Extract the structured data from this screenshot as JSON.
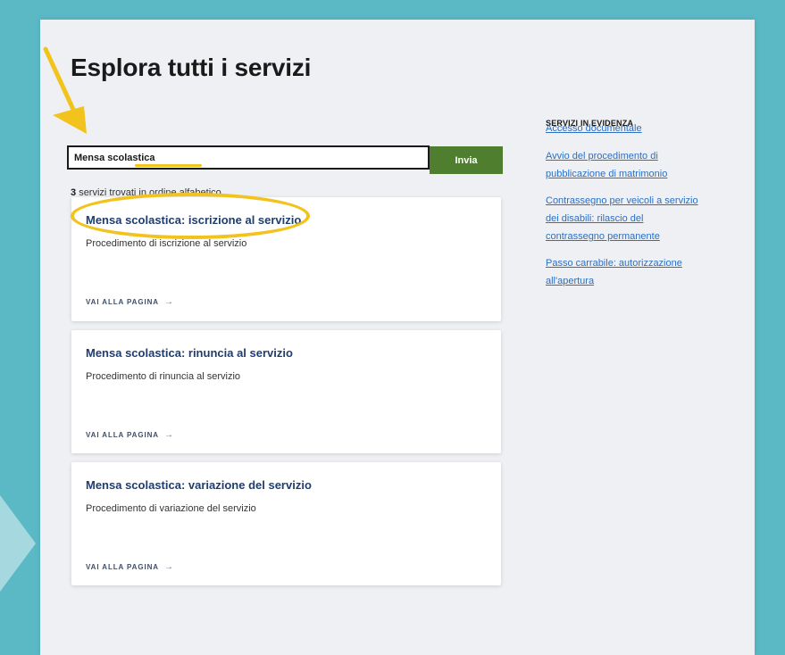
{
  "page": {
    "title": "Esplora tutti i servizi"
  },
  "search": {
    "value": "Mensa scolastica",
    "submit_label": "Invia"
  },
  "results": {
    "count": "3",
    "count_suffix": "servizi trovati in ordine alfabetico",
    "cards": [
      {
        "title": "Mensa scolastica: iscrizione al servizio",
        "description": "Procedimento di iscrizione al servizio",
        "link_label": "VAI ALLA PAGINA"
      },
      {
        "title": "Mensa scolastica: rinuncia al servizio",
        "description": "Procedimento di rinuncia al servizio",
        "link_label": "VAI ALLA PAGINA"
      },
      {
        "title": "Mensa scolastica: variazione del servizio",
        "description": "Procedimento di variazione del servizio",
        "link_label": "VAI ALLA PAGINA"
      }
    ]
  },
  "sidebar": {
    "heading": "SERVIZI IN EVIDENZA",
    "links": [
      "Accesso documentale",
      "Avvio del procedimento di pubblicazione di matrimonio",
      "Contrassegno per veicoli a servizio dei disabili: rilascio del contrassegno permanente",
      "Passo carrabile: autorizzazione all'apertura"
    ]
  },
  "icons": {
    "card_link_arrow": "arrow-right-icon"
  },
  "colors": {
    "frame": "#5bb9c6",
    "page_background": "#eef0f3",
    "submit_button": "#4f7f2e",
    "card_title": "#1f3e6f",
    "sidebar_link": "#2c6fc3",
    "annotation": "#f2c31c"
  }
}
